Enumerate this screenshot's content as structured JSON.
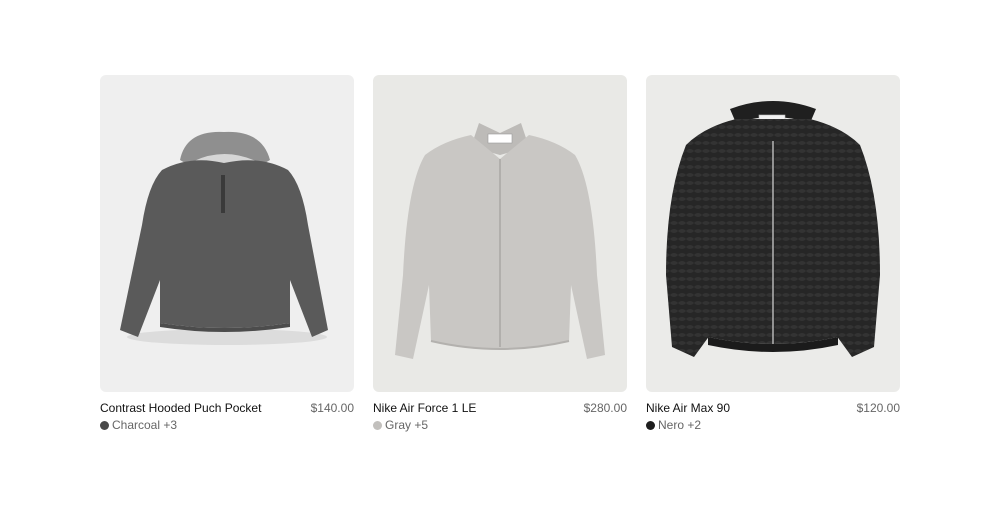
{
  "products": [
    {
      "name": "Contrast Hooded Puch Pocket",
      "price": "$140.00",
      "color_label": "Charcoal +3",
      "swatch_color": "#4a4a4a",
      "image_bg": "#efefef",
      "garment_color": "#5a5a5a"
    },
    {
      "name": "Nike Air Force 1 LE",
      "price": "$280.00",
      "color_label": "Gray +5",
      "swatch_color": "#c2c0bd",
      "image_bg": "#e9e9e6",
      "garment_color": "#c9c7c4"
    },
    {
      "name": "Nike Air Max 90",
      "price": "$120.00",
      "color_label": "Nero +2",
      "swatch_color": "#1e1e1e",
      "image_bg": "#ebebe9",
      "garment_color": "#262626"
    }
  ]
}
